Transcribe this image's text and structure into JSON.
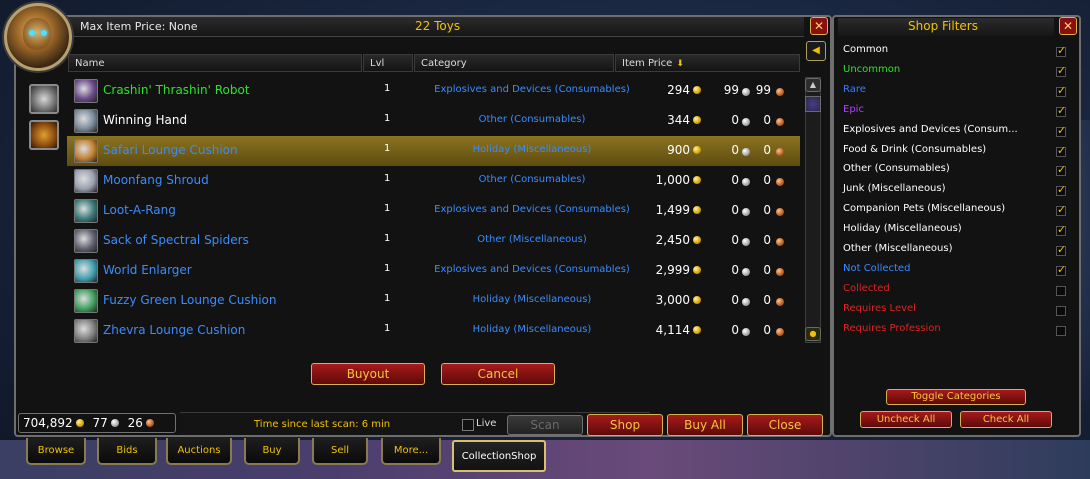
{
  "header": {
    "max_price_label": "Max Item Price: None",
    "toy_count": "22 Toys"
  },
  "columns": {
    "name": "Name",
    "lvl": "Lvl",
    "category": "Category",
    "price": "Item Price"
  },
  "rows": [
    {
      "name": "Crashin' Thrashin' Robot",
      "name_color": "#2ee02e",
      "lvl": "1",
      "category": "Explosives and Devices (Consumables)",
      "gold": "294",
      "silver": "99",
      "copper": "99",
      "selected": false
    },
    {
      "name": "Winning Hand",
      "name_color": "#ffffff",
      "lvl": "1",
      "category": "Other (Consumables)",
      "gold": "344",
      "silver": "0",
      "copper": "0",
      "selected": false
    },
    {
      "name": "Safari Lounge Cushion",
      "name_color": "#3a8cff",
      "lvl": "1",
      "category": "Holiday (Miscellaneous)",
      "gold": "900",
      "silver": "0",
      "copper": "0",
      "selected": true
    },
    {
      "name": "Moonfang Shroud",
      "name_color": "#3a8cff",
      "lvl": "1",
      "category": "Other (Consumables)",
      "gold": "1,000",
      "silver": "0",
      "copper": "0",
      "selected": false
    },
    {
      "name": "Loot-A-Rang",
      "name_color": "#3a8cff",
      "lvl": "1",
      "category": "Explosives and Devices (Consumables)",
      "gold": "1,499",
      "silver": "0",
      "copper": "0",
      "selected": false
    },
    {
      "name": "Sack of Spectral Spiders",
      "name_color": "#3a8cff",
      "lvl": "1",
      "category": "Other (Miscellaneous)",
      "gold": "2,450",
      "silver": "0",
      "copper": "0",
      "selected": false
    },
    {
      "name": "World Enlarger",
      "name_color": "#3a8cff",
      "lvl": "1",
      "category": "Explosives and Devices (Consumables)",
      "gold": "2,999",
      "silver": "0",
      "copper": "0",
      "selected": false
    },
    {
      "name": "Fuzzy Green Lounge Cushion",
      "name_color": "#3a8cff",
      "lvl": "1",
      "category": "Holiday (Miscellaneous)",
      "gold": "3,000",
      "silver": "0",
      "copper": "0",
      "selected": false
    },
    {
      "name": "Zhevra Lounge Cushion",
      "name_color": "#3a8cff",
      "lvl": "1",
      "category": "Holiday (Miscellaneous)",
      "gold": "4,114",
      "silver": "0",
      "copper": "0",
      "selected": false
    }
  ],
  "buttons": {
    "buyout": "Buyout",
    "cancel": "Cancel",
    "scan": "Scan",
    "shop": "Shop",
    "buy_all": "Buy All",
    "close": "Close",
    "toggle_categories": "Toggle Categories",
    "uncheck_all": "Uncheck All",
    "check_all": "Check All"
  },
  "status": {
    "money_gold": "704,892",
    "money_silver": "77",
    "money_copper": "26",
    "scan_time": "Time since last scan: 6 min",
    "live_label": "Live"
  },
  "tabs": [
    "Browse",
    "Bids",
    "Auctions",
    "Buy",
    "Sell",
    "More...",
    "CollectionShop"
  ],
  "filters": {
    "title": "Shop Filters",
    "items": [
      {
        "label": "Common",
        "color": "#ffffff",
        "checked": true
      },
      {
        "label": "Uncommon",
        "color": "#2ee02e",
        "checked": true
      },
      {
        "label": "Rare",
        "color": "#3a7cff",
        "checked": true
      },
      {
        "label": "Epic",
        "color": "#b040ff",
        "checked": true
      },
      {
        "label": "Explosives and Devices (Consum...",
        "color": "#ffffff",
        "checked": true
      },
      {
        "label": "Food & Drink (Consumables)",
        "color": "#ffffff",
        "checked": true
      },
      {
        "label": "Other (Consumables)",
        "color": "#ffffff",
        "checked": true
      },
      {
        "label": "Junk (Miscellaneous)",
        "color": "#ffffff",
        "checked": true
      },
      {
        "label": "Companion Pets (Miscellaneous)",
        "color": "#ffffff",
        "checked": true
      },
      {
        "label": "Holiday (Miscellaneous)",
        "color": "#ffffff",
        "checked": true
      },
      {
        "label": "Other (Miscellaneous)",
        "color": "#ffffff",
        "checked": true
      },
      {
        "label": "Not Collected",
        "color": "#3a8cff",
        "checked": true
      },
      {
        "label": "Collected",
        "color": "#e02020",
        "checked": false
      },
      {
        "label": "Requires Level",
        "color": "#e02020",
        "checked": false
      },
      {
        "label": "Requires Profession",
        "color": "#e02020",
        "checked": false
      }
    ]
  }
}
